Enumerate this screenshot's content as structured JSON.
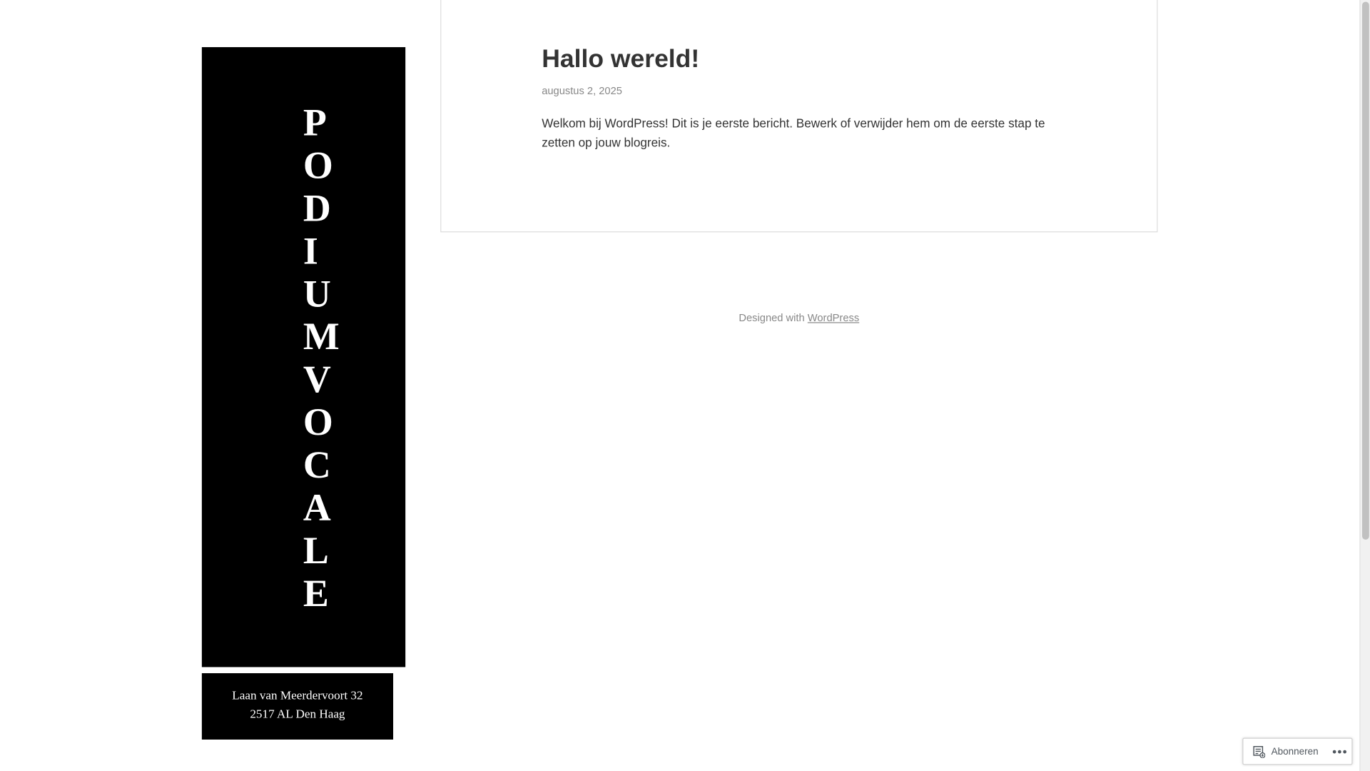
{
  "site": {
    "title_letters": [
      "P",
      "O",
      "D",
      "I",
      "U",
      "M",
      "V",
      "O",
      "C",
      "A",
      "L",
      "E"
    ],
    "address_line1": "Laan van Meerdervoort 32",
    "address_line2": "2517 AL Den Haag"
  },
  "post": {
    "title": "Hallo wereld!",
    "date": "augustus 2, 2025",
    "body": "Welkom bij WordPress! Dit is je eerste bericht. Bewerk of verwijder hem om de eerste stap te zetten op jouw blogreis."
  },
  "footer": {
    "prefix": "Designed with ",
    "link_label": "WordPress"
  },
  "subscribe": {
    "label": "Abonneren",
    "icon": "reader-subscribe-icon",
    "more_label": "•••"
  },
  "colors": {
    "sidebar_bg": "#000000",
    "text": "#333333",
    "muted": "#888888"
  }
}
